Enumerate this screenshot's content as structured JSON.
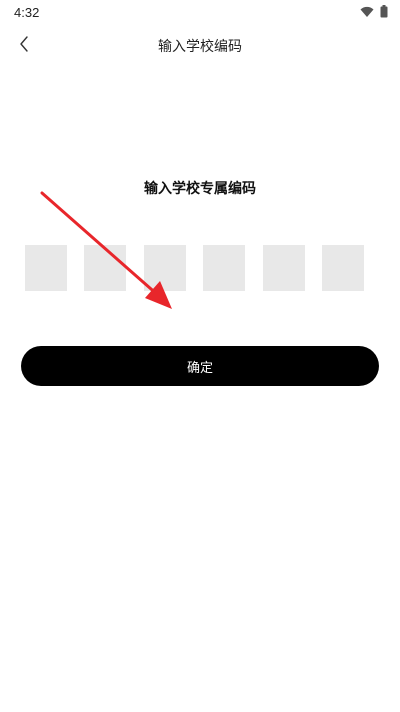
{
  "status_bar": {
    "time": "4:32",
    "icons": [
      "wifi-icon",
      "battery-icon"
    ]
  },
  "header": {
    "back_icon": "chevron-left-icon",
    "title": "输入学校编码"
  },
  "main": {
    "heading": "输入学校专属编码",
    "code_boxes": [
      "",
      "",
      "",
      "",
      "",
      ""
    ],
    "confirm_label": "确定"
  },
  "colors": {
    "accent_button": "#000000",
    "code_box_bg": "#e8e8e8",
    "annotation_arrow": "#e8262b"
  }
}
